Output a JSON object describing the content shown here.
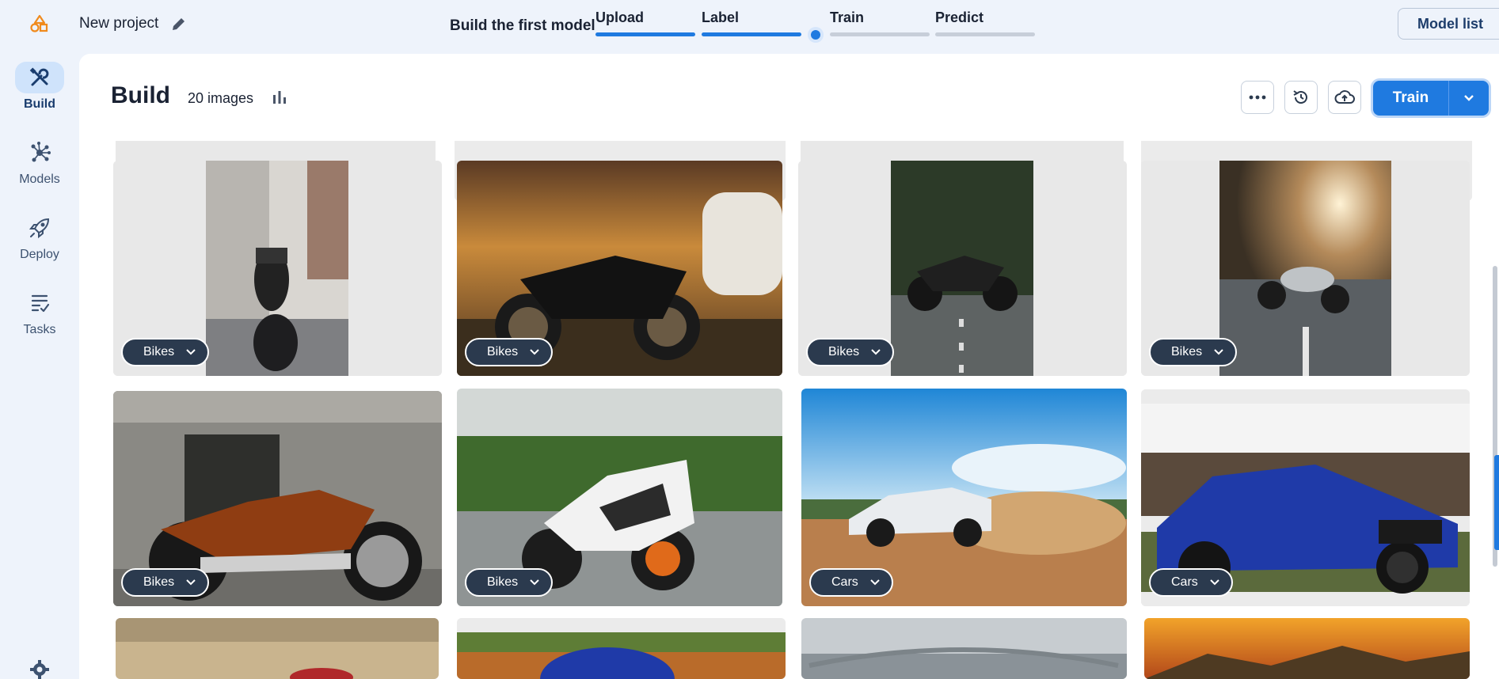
{
  "project": {
    "name": "New project"
  },
  "steps": {
    "title": "Build the first model",
    "items": [
      {
        "label": "Upload",
        "state": "done"
      },
      {
        "label": "Label",
        "state": "done"
      },
      {
        "label": "Train",
        "state": "current"
      },
      {
        "label": "Predict",
        "state": "pending"
      }
    ]
  },
  "header": {
    "model_list_label": "Model list"
  },
  "sidebar": {
    "items": [
      {
        "label": "Build",
        "icon": "tools-icon",
        "active": true
      },
      {
        "label": "Models",
        "icon": "network-icon",
        "active": false
      },
      {
        "label": "Deploy",
        "icon": "rocket-icon",
        "active": false
      },
      {
        "label": "Tasks",
        "icon": "tasks-icon",
        "active": false
      }
    ],
    "settings_icon": "gear-icon"
  },
  "main": {
    "title": "Build",
    "image_count": "20 images",
    "train_label": "Train"
  },
  "colors": {
    "accent": "#1f7ae0",
    "label_chip": "#2b3a4e",
    "background": "#eef3fb"
  },
  "tiles": [
    {
      "label": "Bikes"
    },
    {
      "label": "Bikes"
    },
    {
      "label": "Bikes"
    },
    {
      "label": "Bikes"
    },
    {
      "label": "Bikes"
    },
    {
      "label": "Bikes"
    },
    {
      "label": "Cars"
    },
    {
      "label": "Cars"
    }
  ]
}
